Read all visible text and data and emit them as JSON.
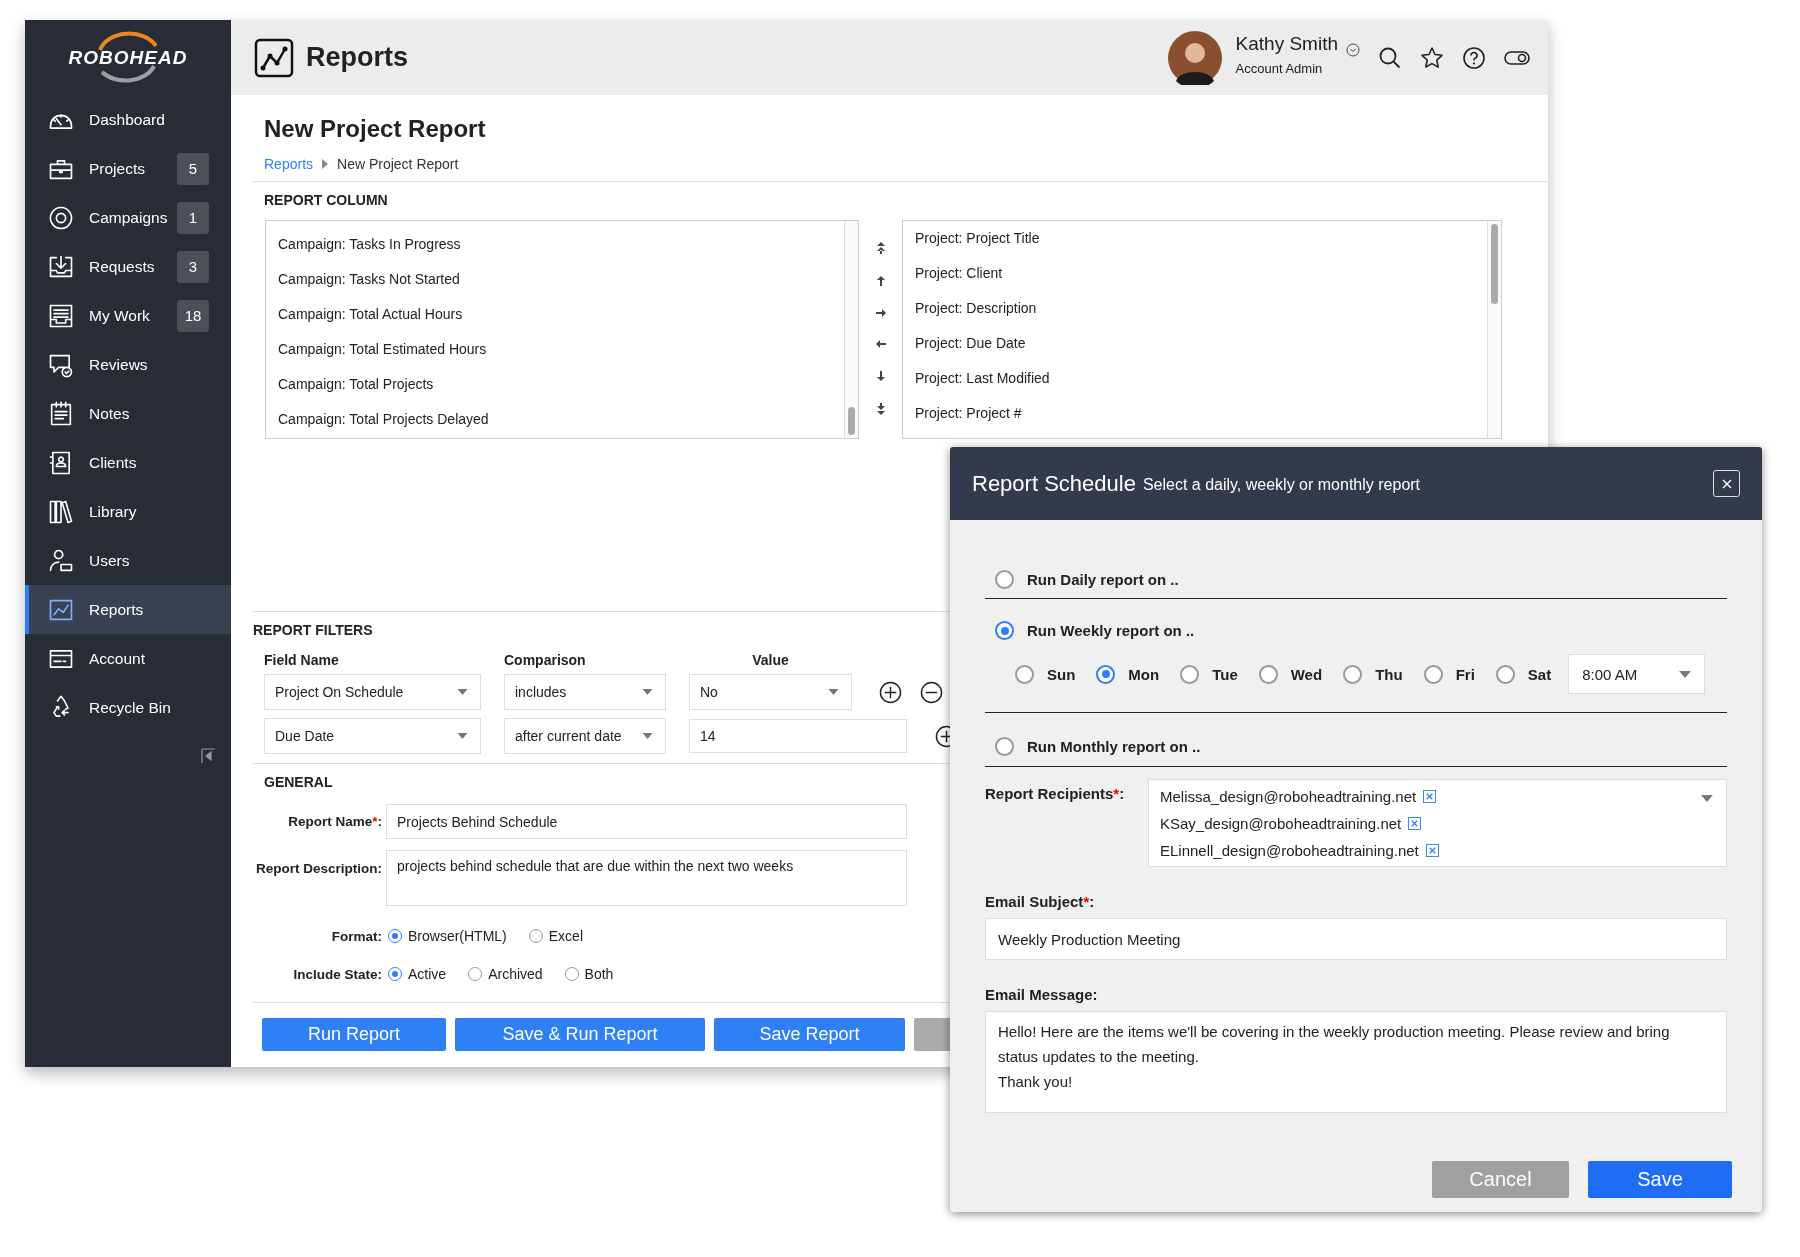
{
  "sidebar": {
    "logo": "ROBOHEAD",
    "items": [
      {
        "label": "Dashboard",
        "selected": false
      },
      {
        "label": "Projects",
        "badge": "5",
        "selected": false
      },
      {
        "label": "Campaigns",
        "badge": "1",
        "selected": false
      },
      {
        "label": "Requests",
        "badge": "3",
        "selected": false
      },
      {
        "label": "My Work",
        "badge": "18",
        "selected": false
      },
      {
        "label": "Reviews",
        "selected": false
      },
      {
        "label": "Notes",
        "selected": false
      },
      {
        "label": "Clients",
        "selected": false
      },
      {
        "label": "Library",
        "selected": false
      },
      {
        "label": "Users",
        "selected": false
      },
      {
        "label": "Reports",
        "selected": true
      },
      {
        "label": "Account",
        "selected": false
      },
      {
        "label": "Recycle Bin",
        "selected": false
      }
    ]
  },
  "header": {
    "title": "Reports",
    "user": {
      "name": "Kathy Smith",
      "role": "Account Admin"
    }
  },
  "page": {
    "title": "New Project Report",
    "breadcrumbs": [
      "Reports",
      "New Project Report"
    ]
  },
  "report_column": {
    "heading": "REPORT COLUMN",
    "available": [
      "Campaign: Tasks In Progress",
      "Campaign: Tasks Not Started",
      "Campaign: Total Actual Hours",
      "Campaign: Total Estimated Hours",
      "Campaign: Total Projects",
      "Campaign: Total Projects Delayed"
    ],
    "selected_columns": [
      "Project: Project Title",
      "Project: Client",
      "Project: Description",
      "Project: Due Date",
      "Project: Last Modified",
      "Project: Project #"
    ]
  },
  "report_filters": {
    "heading": "REPORT FILTERS",
    "columns": [
      "Field Name",
      "Comparison",
      "Value"
    ],
    "rows": [
      {
        "field": "Project On Schedule",
        "comparison": "includes",
        "value": "No",
        "kind": "select"
      },
      {
        "field": "Due Date",
        "comparison": "after current date",
        "value": "14",
        "kind": "input"
      }
    ]
  },
  "general": {
    "heading": "GENERAL",
    "report_name": {
      "label": "Report Name",
      "required_mark": "*",
      "suffix": ":",
      "value": "Projects Behind Schedule"
    },
    "report_description": {
      "label": "Report Description:",
      "value": "projects behind schedule that are due within the next two weeks"
    },
    "format": {
      "label": "Format:",
      "options": [
        {
          "label": "Browser(HTML)",
          "selected": true
        },
        {
          "label": "Excel",
          "selected": false
        }
      ]
    },
    "include_state": {
      "label": "Include State:",
      "options": [
        {
          "label": "Active",
          "selected": true
        },
        {
          "label": "Archived",
          "selected": false
        },
        {
          "label": "Both",
          "selected": false
        }
      ]
    }
  },
  "buttons": [
    "Run Report",
    "Save & Run Report",
    "Save Report"
  ],
  "schedule_dialog": {
    "title": "Report Schedule",
    "subtitle": "Select a daily, weekly or monthly report",
    "options": [
      {
        "label": "Run Daily report on ..",
        "selected": false
      },
      {
        "label": "Run Weekly report on ..",
        "selected": true,
        "days": [
          {
            "label": "Sun",
            "selected": false
          },
          {
            "label": "Mon",
            "selected": true
          },
          {
            "label": "Tue",
            "selected": false
          },
          {
            "label": "Wed",
            "selected": false
          },
          {
            "label": "Thu",
            "selected": false
          },
          {
            "label": "Fri",
            "selected": false
          },
          {
            "label": "Sat",
            "selected": false
          }
        ],
        "time": "8:00 AM"
      },
      {
        "label": "Run Monthly report on ..",
        "selected": false
      }
    ],
    "recipients": {
      "label": "Report Recipients",
      "required_mark": "*",
      "suffix": ":",
      "emails": [
        "Melissa_design@roboheadtraining.net",
        "KSay_design@roboheadtraining.net",
        "ELinnell_design@roboheadtraining.net"
      ]
    },
    "email_subject": {
      "label": "Email Subject",
      "required_mark": "*",
      "suffix": ":",
      "value": "Weekly Production Meeting"
    },
    "email_message": {
      "label": "Email Message:",
      "lines": [
        "Hello! Here are the items we'll be covering in the weekly production meeting. Please review and bring status updates to the meeting.",
        "Thank you!"
      ]
    },
    "buttons": {
      "cancel": "Cancel",
      "save": "Save"
    }
  }
}
